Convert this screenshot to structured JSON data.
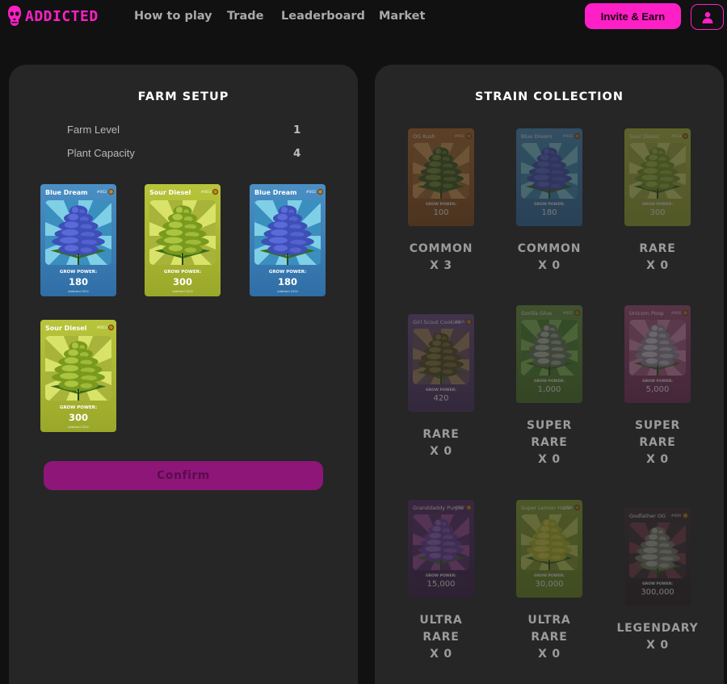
{
  "nav": {
    "logo_text": "ADDICTED",
    "links": [
      "How to play",
      "Trade",
      "Leaderboard",
      "Market"
    ],
    "invite_label": "Invite & Earn"
  },
  "farm": {
    "title": "FARM SETUP",
    "stats": [
      {
        "label": "Farm Level",
        "value": "1"
      },
      {
        "label": "Plant Capacity",
        "value": "4"
      }
    ],
    "cards": [
      {
        "name": "Blue Dream",
        "number": "#002",
        "gp_label": "GROW POWER:",
        "grow_power": "180",
        "footer": "Addicted 2024",
        "theme": "blue"
      },
      {
        "name": "Sour Diesel",
        "number": "#003",
        "gp_label": "GROW POWER:",
        "grow_power": "300",
        "footer": "Addicted 2024",
        "theme": "green"
      },
      {
        "name": "Blue Dream",
        "number": "#002",
        "gp_label": "GROW POWER:",
        "grow_power": "180",
        "footer": "Addicted 2024",
        "theme": "blue"
      },
      {
        "name": "Sour Diesel",
        "number": "#003",
        "gp_label": "GROW POWER:",
        "grow_power": "300",
        "footer": "Addicted 2024",
        "theme": "green"
      }
    ],
    "confirm_label": "Confirm"
  },
  "collection": {
    "title": "STRAIN COLLECTION",
    "items": [
      {
        "name": "OG Kush",
        "number": "#001",
        "gp_label": "GROW POWER:",
        "grow_power": "100",
        "rarity": [
          "COMMON"
        ],
        "count": "X 3",
        "theme": "orange"
      },
      {
        "name": "Blue Dream",
        "number": "#002",
        "gp_label": "GROW POWER:",
        "grow_power": "180",
        "rarity": [
          "COMMON"
        ],
        "count": "X 0",
        "theme": "blue"
      },
      {
        "name": "Sour Diesel",
        "number": "#003",
        "gp_label": "GROW POWER:",
        "grow_power": "300",
        "rarity": [
          "RARE"
        ],
        "count": "X 0",
        "theme": "green"
      },
      {
        "name": "Girl Scout Cookies",
        "number": "#004",
        "gp_label": "GROW POWER:",
        "grow_power": "420",
        "rarity": [
          "RARE"
        ],
        "count": "X 0",
        "theme": "purple"
      },
      {
        "name": "Gorilla Glue",
        "number": "#005",
        "gp_label": "GROW POWER:",
        "grow_power": "1,000",
        "rarity": [
          "SUPER",
          "RARE"
        ],
        "count": "X 0",
        "theme": "grass"
      },
      {
        "name": "Unicorn Poop",
        "number": "#006",
        "gp_label": "GROW POWER:",
        "grow_power": "5,000",
        "rarity": [
          "SUPER",
          "RARE"
        ],
        "count": "X 0",
        "theme": "pink"
      },
      {
        "name": "Granddaddy Purple",
        "number": "#007",
        "gp_label": "GROW POWER:",
        "grow_power": "15,000",
        "rarity": [
          "ULTRA",
          "RARE"
        ],
        "count": "X 0",
        "theme": "violet"
      },
      {
        "name": "Super Lemon Haze",
        "number": "#008",
        "gp_label": "GROW POWER:",
        "grow_power": "30,000",
        "rarity": [
          "ULTRA",
          "RARE"
        ],
        "count": "X 0",
        "theme": "lemon"
      },
      {
        "name": "Godfather OG",
        "number": "#009",
        "gp_label": "GROW POWER:",
        "grow_power": "300,000",
        "rarity": [
          "LEGENDARY"
        ],
        "count": "X 0",
        "theme": "dark"
      }
    ]
  },
  "colors": {
    "accent": "#ff1fc7",
    "panel": "#262626",
    "background": "#111111",
    "confirm": "#8e1679"
  }
}
